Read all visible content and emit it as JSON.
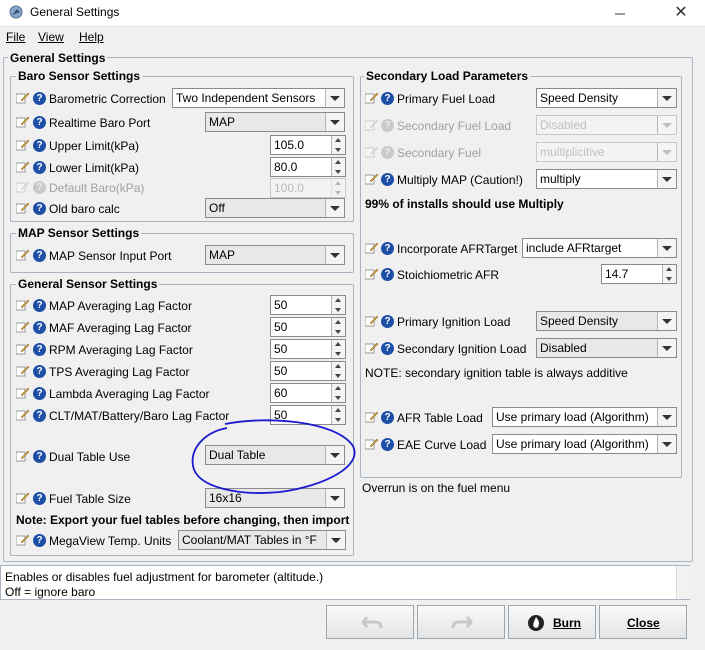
{
  "window": {
    "title": "General Settings"
  },
  "menu": {
    "file": "File",
    "view": "View",
    "help": "Help"
  },
  "outer_group_title": "General Settings",
  "baro": {
    "title": "Baro Sensor Settings",
    "rows": [
      {
        "label": "Barometric Correction",
        "value": "Two Independent Sensors"
      },
      {
        "label": "Realtime Baro Port",
        "value": "MAP"
      },
      {
        "label": "Upper Limit(kPa)",
        "value": "105.0"
      },
      {
        "label": "Lower Limit(kPa)",
        "value": "80.0"
      },
      {
        "label": "Default Baro(kPa)",
        "value": "100.0"
      },
      {
        "label": "Old baro calc",
        "value": "Off"
      }
    ]
  },
  "map": {
    "title": "MAP Sensor Settings",
    "rows": [
      {
        "label": "MAP Sensor Input Port",
        "value": "MAP"
      }
    ]
  },
  "general": {
    "title": "General Sensor Settings",
    "rows": [
      {
        "label": "MAP Averaging Lag Factor",
        "value": "50"
      },
      {
        "label": "MAF Averaging Lag Factor",
        "value": "50"
      },
      {
        "label": "RPM Averaging Lag Factor",
        "value": "50"
      },
      {
        "label": "TPS Averaging Lag Factor",
        "value": "50"
      },
      {
        "label": "Lambda Averaging Lag Factor",
        "value": "60"
      },
      {
        "label": "CLT/MAT/Battery/Baro Lag Factor",
        "value": "50"
      },
      {
        "label": "Dual Table Use",
        "value": "Dual Table"
      },
      {
        "label": "Fuel Table Size",
        "value": "16x16"
      }
    ],
    "note": "Note: Export your fuel tables before changing, then import",
    "megaview": {
      "label": "MegaView Temp. Units",
      "value": "Coolant/MAT Tables in °F"
    }
  },
  "secondary": {
    "title": "Secondary Load Parameters",
    "rows": [
      {
        "label": "Primary Fuel Load",
        "value": "Speed Density"
      },
      {
        "label": "Secondary Fuel Load",
        "value": "Disabled"
      },
      {
        "label": "Secondary Fuel",
        "value": "multiplicitive"
      },
      {
        "label": "Multiply MAP (Caution!)",
        "value": "multiply"
      }
    ],
    "multiply_note": "99% of installs should use Multiply",
    "afr_rows": [
      {
        "label": "Incorporate AFRTarget",
        "value": "include AFRtarget"
      },
      {
        "label": "Stoichiometric AFR",
        "value": "14.7"
      }
    ],
    "ign_rows": [
      {
        "label": "Primary Ignition Load",
        "value": "Speed Density"
      },
      {
        "label": "Secondary Ignition Load",
        "value": "Disabled"
      }
    ],
    "ign_note": "NOTE: secondary ignition table is always additive",
    "load_rows": [
      {
        "label": "AFR Table Load",
        "value": "Use primary load (Algorithm)"
      },
      {
        "label": "EAE Curve Load",
        "value": "Use primary load (Algorithm)"
      }
    ]
  },
  "overrun_note": "Overrun is on the fuel menu",
  "status": {
    "line1": "Enables or disables fuel adjustment for barometer (altitude.)",
    "line2": "Off = ignore baro"
  },
  "buttons": {
    "burn": "Burn",
    "close": "Close"
  },
  "colors": {
    "help_icon": "#1d4fa6",
    "annotation": "#1a1ad0",
    "group_border": "#a9b4c2"
  }
}
